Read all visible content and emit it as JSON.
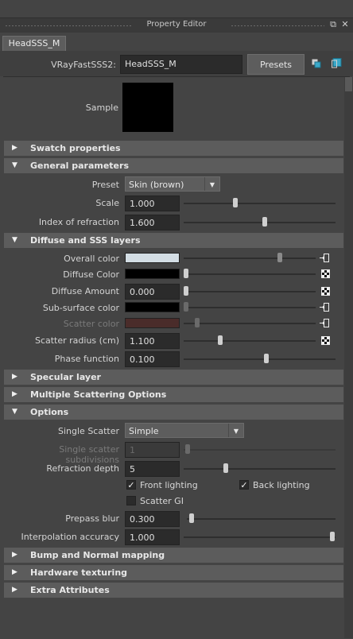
{
  "window": {
    "title": "Property Editor",
    "tab": "HeadSSS_M"
  },
  "node": {
    "type_label": "VRayFastSSS2:",
    "name": "HeadSSS_M",
    "presets_label": "Presets"
  },
  "sample": {
    "label": "Sample"
  },
  "sections": {
    "swatch": "Swatch properties",
    "general": "General parameters",
    "diffuse": "Diffuse and SSS layers",
    "specular": "Specular layer",
    "multiple": "Multiple Scattering Options",
    "options": "Options",
    "bump": "Bump and Normal mapping",
    "hardware": "Hardware texturing",
    "extra": "Extra Attributes"
  },
  "general": {
    "preset_label": "Preset",
    "preset_value": "Skin (brown)",
    "scale_label": "Scale",
    "scale_value": "1.000",
    "scale_slider": 0.43,
    "ior_label": "Index of refraction",
    "ior_value": "1.600",
    "ior_slider": 0.53
  },
  "diffuse": {
    "overall_label": "Overall color",
    "overall_color": "#d3dde4",
    "overall_slider": 0.83,
    "diffuse_color_label": "Diffuse Color",
    "diffuse_color": "#000000",
    "amount_label": "Diffuse Amount",
    "amount_value": "0.000",
    "amount_slider": 0.0,
    "subsurface_label": "Sub-surface color",
    "subsurface_color": "#000000",
    "scatter_color_label": "Scatter color",
    "scatter_color": "#4a2c2a",
    "scatter_slider": 0.12,
    "radius_label": "Scatter radius (cm)",
    "radius_value": "1.100",
    "radius_slider": 0.27,
    "phase_label": "Phase function",
    "phase_value": "0.100",
    "phase_slider": 0.55
  },
  "options": {
    "single_scatter_label": "Single Scatter",
    "single_scatter_value": "Simple",
    "subdiv_label": "Single scatter subdivisions",
    "subdiv_value": "1",
    "subdiv_slider": 0.0,
    "refr_depth_label": "Refraction depth",
    "refr_depth_value": "5",
    "refr_depth_slider": 0.28,
    "front_lighting": "Front lighting",
    "front_checked": true,
    "back_lighting": "Back lighting",
    "back_checked": true,
    "scatter_gi": "Scatter GI",
    "scatter_gi_checked": false,
    "prepass_label": "Prepass blur",
    "prepass_value": "0.300",
    "prepass_slider": 0.02,
    "interp_label": "Interpolation accuracy",
    "interp_value": "1.000",
    "interp_slider": 1.0
  }
}
